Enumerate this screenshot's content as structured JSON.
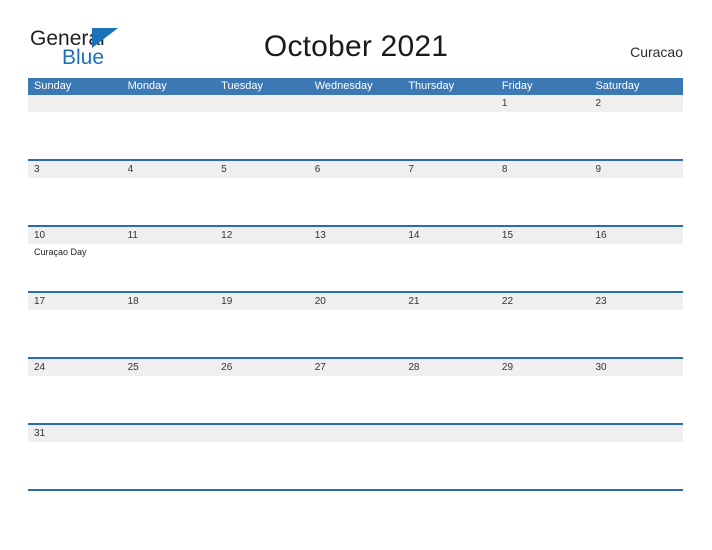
{
  "brand": {
    "name_part1": "General",
    "name_part2": "Blue",
    "flag_icon": "triangle-flag-icon",
    "accent_color": "#1b72b8"
  },
  "header": {
    "title": "October 2021",
    "region": "Curacao"
  },
  "calendar": {
    "header_bg_color": "#3c78b4",
    "date_band_color": "#efefef",
    "row_rule_color": "#2a6cad",
    "weekdays": [
      "Sunday",
      "Monday",
      "Tuesday",
      "Wednesday",
      "Thursday",
      "Friday",
      "Saturday"
    ],
    "weeks": [
      {
        "days": [
          {
            "num": "",
            "event": ""
          },
          {
            "num": "",
            "event": ""
          },
          {
            "num": "",
            "event": ""
          },
          {
            "num": "",
            "event": ""
          },
          {
            "num": "",
            "event": ""
          },
          {
            "num": "1",
            "event": ""
          },
          {
            "num": "2",
            "event": ""
          }
        ]
      },
      {
        "days": [
          {
            "num": "3",
            "event": ""
          },
          {
            "num": "4",
            "event": ""
          },
          {
            "num": "5",
            "event": ""
          },
          {
            "num": "6",
            "event": ""
          },
          {
            "num": "7",
            "event": ""
          },
          {
            "num": "8",
            "event": ""
          },
          {
            "num": "9",
            "event": ""
          }
        ]
      },
      {
        "days": [
          {
            "num": "10",
            "event": "Curaçao Day"
          },
          {
            "num": "11",
            "event": ""
          },
          {
            "num": "12",
            "event": ""
          },
          {
            "num": "13",
            "event": ""
          },
          {
            "num": "14",
            "event": ""
          },
          {
            "num": "15",
            "event": ""
          },
          {
            "num": "16",
            "event": ""
          }
        ]
      },
      {
        "days": [
          {
            "num": "17",
            "event": ""
          },
          {
            "num": "18",
            "event": ""
          },
          {
            "num": "19",
            "event": ""
          },
          {
            "num": "20",
            "event": ""
          },
          {
            "num": "21",
            "event": ""
          },
          {
            "num": "22",
            "event": ""
          },
          {
            "num": "23",
            "event": ""
          }
        ]
      },
      {
        "days": [
          {
            "num": "24",
            "event": ""
          },
          {
            "num": "25",
            "event": ""
          },
          {
            "num": "26",
            "event": ""
          },
          {
            "num": "27",
            "event": ""
          },
          {
            "num": "28",
            "event": ""
          },
          {
            "num": "29",
            "event": ""
          },
          {
            "num": "30",
            "event": ""
          }
        ]
      },
      {
        "days": [
          {
            "num": "31",
            "event": ""
          },
          {
            "num": "",
            "event": ""
          },
          {
            "num": "",
            "event": ""
          },
          {
            "num": "",
            "event": ""
          },
          {
            "num": "",
            "event": ""
          },
          {
            "num": "",
            "event": ""
          },
          {
            "num": "",
            "event": ""
          }
        ]
      }
    ]
  }
}
